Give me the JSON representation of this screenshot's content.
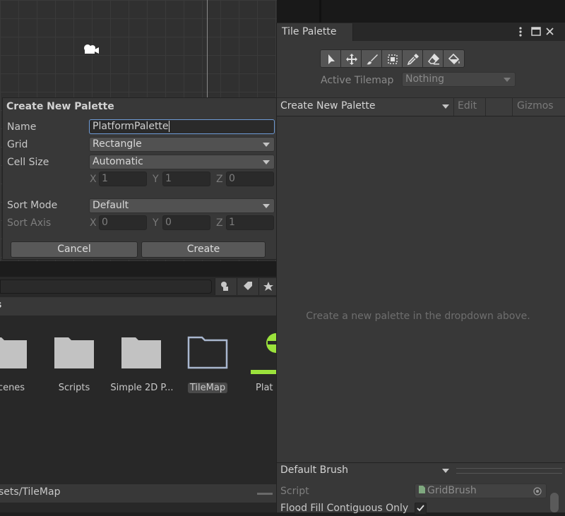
{
  "popup": {
    "title": "Create New Palette",
    "name_label": "Name",
    "name_value": "PlatformPalette",
    "grid_label": "Grid",
    "grid_value": "Rectangle",
    "cell_size_label": "Cell Size",
    "cell_size_value": "Automatic",
    "cell_x": "1",
    "cell_y": "1",
    "cell_z": "0",
    "sort_mode_label": "Sort Mode",
    "sort_mode_value": "Default",
    "sort_axis_label": "Sort Axis",
    "sort_x": "0",
    "sort_y": "0",
    "sort_z": "1",
    "axis_x": "X",
    "axis_y": "Y",
    "axis_z": "Z",
    "cancel_label": "Cancel",
    "create_label": "Create"
  },
  "project": {
    "path_header": "s",
    "folders": [
      {
        "label": "cenes"
      },
      {
        "label": "Scripts"
      },
      {
        "label": "Simple 2D P..."
      },
      {
        "label": "TileMap"
      },
      {
        "label": "Plat"
      }
    ],
    "footer_path": "sets/TileMap"
  },
  "tile_palette": {
    "tab_title": "Tile Palette",
    "active_tilemap_label": "Active Tilemap",
    "active_tilemap_value": "Nothing",
    "palette_dropdown": "Create New Palette",
    "edit_label": "Edit",
    "gizmos_label": "Gizmos",
    "empty_message": "Create a new palette in the dropdown above.",
    "brush_dropdown": "Default Brush",
    "script_label": "Script",
    "script_value": "GridBrush",
    "flood_fill_label": "Flood Fill Contiguous Only",
    "tools": [
      "select-icon",
      "move-icon",
      "paint-brush-icon",
      "box-fill-icon",
      "picker-icon",
      "eraser-icon",
      "fill-bucket-icon"
    ]
  },
  "colors": {
    "accent_focus": "#6f9bd6",
    "tilemap_folder": "#a9b7cf",
    "green_asset": "#9be23c"
  }
}
